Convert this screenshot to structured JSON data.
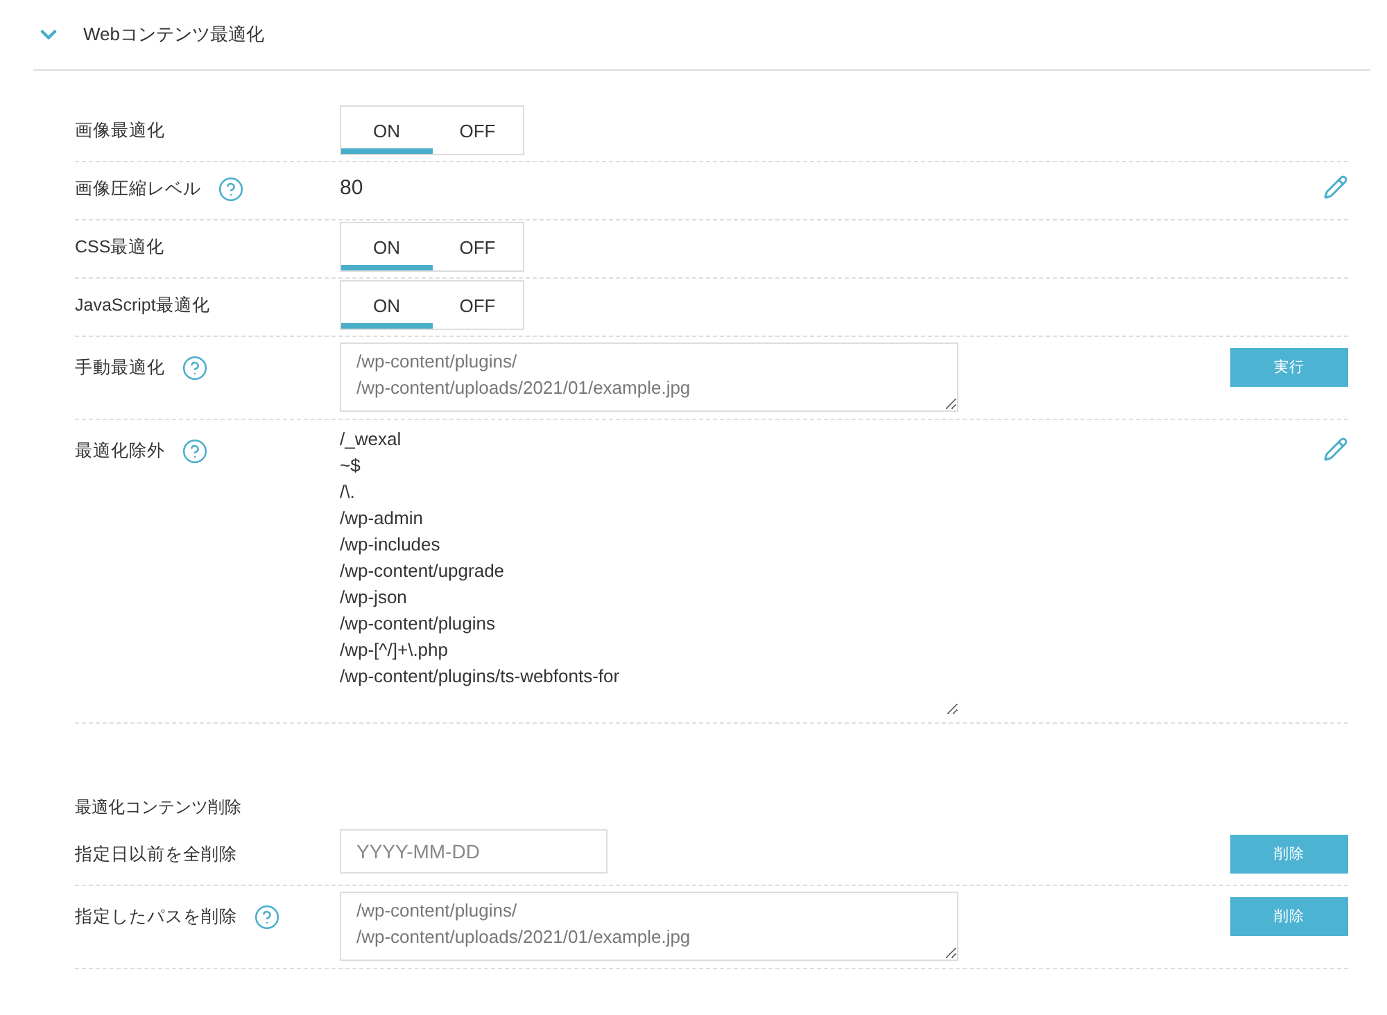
{
  "section": {
    "title": "Webコンテンツ最適化",
    "expanded": true
  },
  "rows": [
    {
      "kind": "toggle",
      "label": "画像最適化",
      "options": [
        {
          "label": "ON",
          "selected": true
        },
        {
          "label": "OFF",
          "selected": false
        }
      ]
    },
    {
      "kind": "value",
      "label": "画像圧縮レベル",
      "help": true,
      "value": "80",
      "editable": true
    },
    {
      "kind": "toggle",
      "label": "CSS最適化",
      "options": [
        {
          "label": "ON",
          "selected": true
        },
        {
          "label": "OFF",
          "selected": false
        }
      ]
    },
    {
      "kind": "toggle",
      "label": "JavaScript最適化",
      "options": [
        {
          "label": "ON",
          "selected": true
        },
        {
          "label": "OFF",
          "selected": false
        }
      ]
    },
    {
      "kind": "textarea",
      "label": "手動最適化",
      "help": true,
      "placeholder": "/wp-content/plugins/\n/wp-content/uploads/2021/01/example.jpg",
      "button": "実行"
    },
    {
      "kind": "list",
      "label": "最適化除外",
      "help": true,
      "editable": true,
      "lines": [
        "/_wexal",
        "~$",
        "/\\.",
        "/wp-admin",
        "/wp-includes",
        "/wp-content/upgrade",
        "/wp-json",
        "/wp-content/plugins",
        "/wp-[^/]+\\.php",
        "/wp-content/plugins/ts-webfonts-for"
      ]
    },
    {
      "kind": "heading",
      "label": "最適化コンテンツ削除"
    },
    {
      "kind": "date",
      "label": "指定日以前を全削除",
      "placeholder": "YYYY-MM-DD",
      "button": "削除"
    },
    {
      "kind": "textarea",
      "label": "指定したパスを削除",
      "help": true,
      "placeholder": "/wp-content/plugins/\n/wp-content/uploads/2021/01/example.jpg",
      "button": "削除"
    }
  ]
}
